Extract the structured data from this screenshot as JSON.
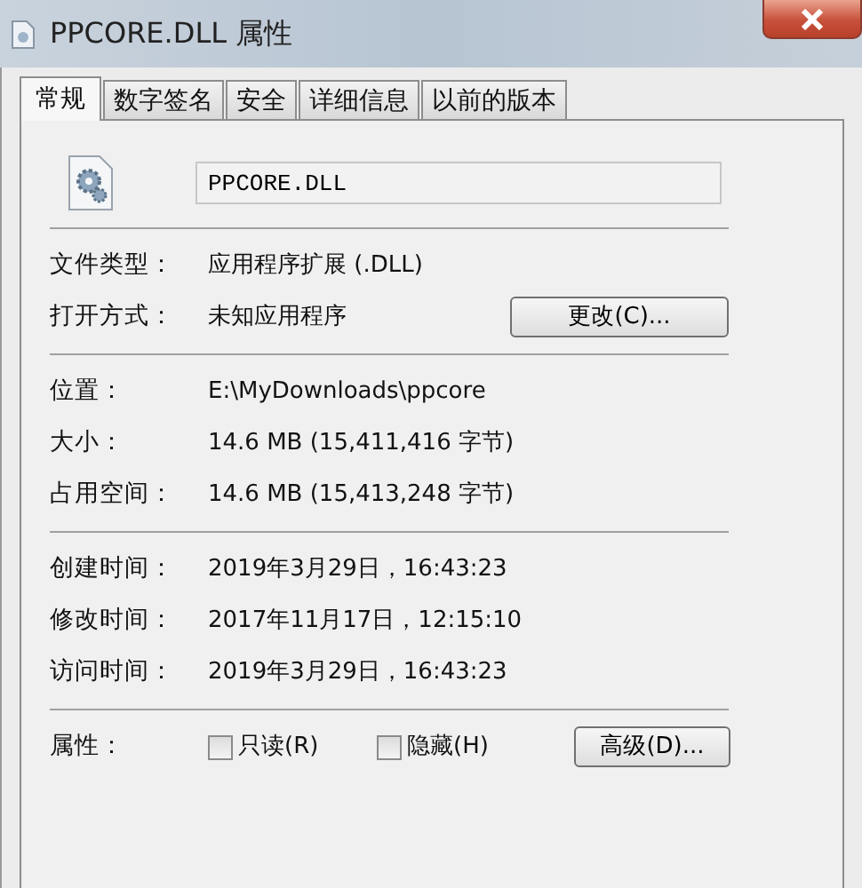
{
  "window": {
    "title": "PPCORE.DLL 属性"
  },
  "tabs": [
    {
      "label": "常规",
      "selected": true
    },
    {
      "label": "数字签名",
      "selected": false
    },
    {
      "label": "安全",
      "selected": false
    },
    {
      "label": "详细信息",
      "selected": false
    },
    {
      "label": "以前的版本",
      "selected": false
    }
  ],
  "file_name": "PPCORE.DLL",
  "groups": [
    [
      {
        "label": "文件类型：",
        "value": "应用程序扩展 (.DLL)"
      },
      {
        "label": "打开方式：",
        "value": "未知应用程序",
        "button": "更改(C)..."
      }
    ],
    [
      {
        "label": "位置：",
        "value": "E:\\MyDownloads\\ppcore"
      },
      {
        "label": "大小：",
        "value": "14.6 MB (15,411,416 字节)"
      },
      {
        "label": "占用空间：",
        "value": "14.6 MB (15,413,248 字节)"
      }
    ],
    [
      {
        "label": "创建时间：",
        "value": "2019年3月29日，16:43:23"
      },
      {
        "label": "修改时间：",
        "value": "2017年11月17日，12:15:10"
      },
      {
        "label": "访问时间：",
        "value": "2019年3月29日，16:43:23"
      }
    ]
  ],
  "attributes": {
    "label": "属性：",
    "checkboxes": [
      {
        "label": "只读(R)",
        "checked": false
      },
      {
        "label": "隐藏(H)",
        "checked": false
      }
    ],
    "button": "高级(D)..."
  }
}
